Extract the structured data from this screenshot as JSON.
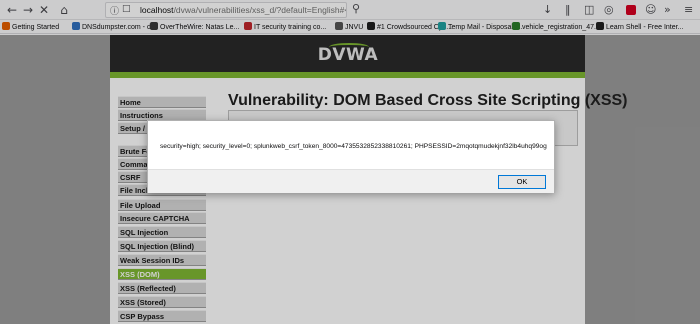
{
  "browser": {
    "url_host": "localhost",
    "url_path": "/dvwa/vulnerabilities/xss_d/?default=English#<script>alert(document.cookie)</scr",
    "bookmarks": [
      {
        "label": "Getting Started",
        "color": "#e66000"
      },
      {
        "label": "DNSdumpster.com - d...",
        "color": "#2f6fbf"
      },
      {
        "label": "OverTheWire: Natas Le...",
        "color": "#3a3a3a"
      },
      {
        "label": "IT security training co...",
        "color": "#c1272d"
      },
      {
        "label": "JNVU",
        "color": "#555555"
      },
      {
        "label": "#1 Crowdsourced Cyb...",
        "color": "#1f1f1f"
      },
      {
        "label": "Temp Mail - Disposabl...",
        "color": "#1fa0a0"
      },
      {
        "label": "vehicle_registration_47...",
        "color": "#2a7d2a"
      },
      {
        "label": "Learn Shell - Free Inter...",
        "color": "#222222"
      }
    ],
    "toolbar_icons": [
      "back-icon",
      "forward-icon",
      "reload-icon",
      "home-icon",
      "info-icon",
      "lock-icon",
      "search-icon",
      "library-icon",
      "sidebar-icon",
      "extension-icon",
      "profile-icon",
      "menu-icon"
    ]
  },
  "dvwa": {
    "logo_text": "DVWA",
    "title": "Vulnerability: DOM Based Cross Site Scripting (XSS)",
    "menu": [
      "Home",
      "Instructions",
      "Setup / Reset DB",
      "Brute Force",
      "Command Injection",
      "CSRF",
      "File Inclusion",
      "File Upload",
      "Insecure CAPTCHA",
      "SQL Injection",
      "SQL Injection (Blind)",
      "Weak Session IDs",
      "XSS (DOM)",
      "XSS (Reflected)",
      "XSS (Stored)",
      "CSP Bypass"
    ],
    "active_item": "XSS (DOM)",
    "accent_color": "#7fb833"
  },
  "dialog": {
    "message": "security=high; security_level=0; splunkweb_csrf_token_8000=4735532852338810261; PHPSESSID=2mqotqmudekjnf32lb4uhq99og",
    "ok_label": "OK"
  }
}
